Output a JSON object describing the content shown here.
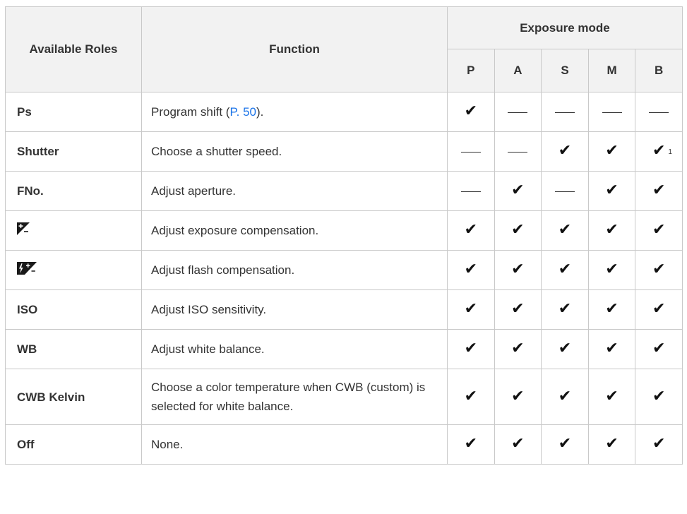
{
  "header": {
    "roles_label": "Available Roles",
    "function_label": "Function",
    "exposure_mode_label": "Exposure mode",
    "modes": [
      "P",
      "A",
      "S",
      "M",
      "B"
    ]
  },
  "rows": [
    {
      "role": "Ps",
      "function_text": "Program shift (",
      "function_link": "P. 50",
      "function_suffix": ").",
      "marks": [
        "check",
        "dash",
        "dash",
        "dash",
        "dash"
      ]
    },
    {
      "role": "Shutter",
      "function_text": "Choose a shutter speed.",
      "marks": [
        "dash",
        "dash",
        "check",
        "check",
        "check"
      ],
      "footnote_mode_index": 4,
      "footnote": "1"
    },
    {
      "role": "FNo.",
      "function_text": "Adjust aperture.",
      "marks": [
        "dash",
        "check",
        "dash",
        "check",
        "check"
      ]
    },
    {
      "role_icon": "exposure-compensation-icon",
      "function_text": "Adjust exposure compensation.",
      "marks": [
        "check",
        "check",
        "check",
        "check",
        "check"
      ]
    },
    {
      "role_icon": "flash-compensation-icon",
      "function_text": "Adjust flash compensation.",
      "marks": [
        "check",
        "check",
        "check",
        "check",
        "check"
      ]
    },
    {
      "role": "ISO",
      "function_text": "Adjust ISO sensitivity.",
      "marks": [
        "check",
        "check",
        "check",
        "check",
        "check"
      ]
    },
    {
      "role": "WB",
      "function_text": "Adjust white balance.",
      "marks": [
        "check",
        "check",
        "check",
        "check",
        "check"
      ]
    },
    {
      "role": "CWB Kelvin",
      "function_text": "Choose a color temperature when CWB (custom) is selected for white balance.",
      "marks": [
        "check",
        "check",
        "check",
        "check",
        "check"
      ],
      "tall": true
    },
    {
      "role": "Off",
      "function_text": "None.",
      "marks": [
        "check",
        "check",
        "check",
        "check",
        "check"
      ]
    }
  ],
  "colors": {
    "header_bg": "#f2f2f2",
    "border": "#c9c9c9",
    "link": "#1a73e8",
    "text": "#333333"
  }
}
